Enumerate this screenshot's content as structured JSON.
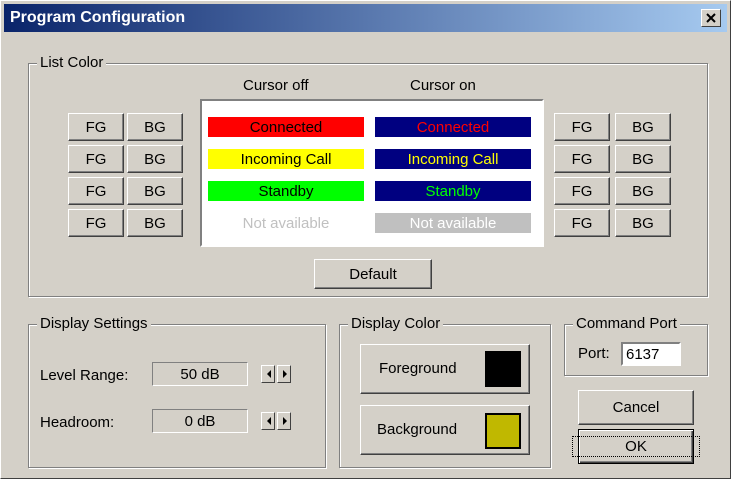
{
  "window": {
    "title": "Program Configuration"
  },
  "list_color": {
    "legend": "List Color",
    "cursor_off_header": "Cursor off",
    "cursor_on_header": "Cursor on",
    "fg_label": "FG",
    "bg_label": "BG",
    "default_button": "Default",
    "rows": [
      {
        "text": "Connected",
        "off_bg": "#ff0000",
        "off_fg": "#ff0000",
        "on_bg": "#000080",
        "on_fg": "#ff0000"
      },
      {
        "text": "Incoming Call",
        "off_bg": "#ffff00",
        "off_fg": "#000000",
        "on_bg": "#000080",
        "on_fg": "#ffff00"
      },
      {
        "text": "Standby",
        "off_bg": "#00ff00",
        "off_fg": "#000000",
        "on_bg": "#000080",
        "on_fg": "#00ff00"
      },
      {
        "text": "Not available",
        "off_bg": "#ffffff",
        "off_fg": "#c0c0c0",
        "on_bg": "#c0c0c0",
        "on_fg": "#ffffff"
      }
    ]
  },
  "display_settings": {
    "legend": "Display Settings",
    "level_range_label": "Level Range:",
    "level_range_value": "50 dB",
    "headroom_label": "Headroom:",
    "headroom_value": "0 dB"
  },
  "display_color": {
    "legend": "Display Color",
    "foreground_label": "Foreground",
    "foreground_color": "#000000",
    "background_label": "Background",
    "background_color": "#c0b800"
  },
  "command_port": {
    "legend": "Command Port",
    "port_label": "Port:",
    "port_value": "6137"
  },
  "buttons": {
    "cancel": "Cancel",
    "ok": "OK"
  }
}
